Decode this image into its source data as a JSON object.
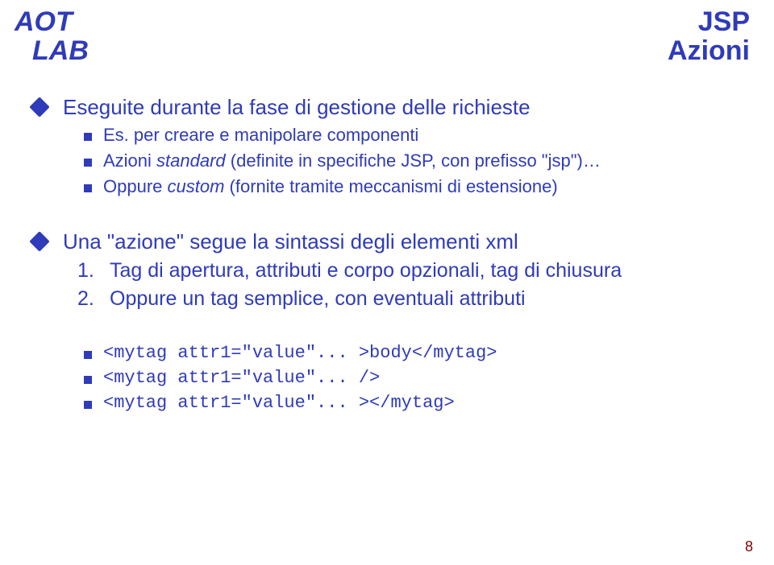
{
  "logo": {
    "line1": "AOT",
    "line2": "LAB"
  },
  "title": {
    "line1": "JSP",
    "line2": "Azioni"
  },
  "list1": {
    "main": "Eseguite durante la fase di gestione delle richieste",
    "sub1_prefix": "Es. per creare e manipolare componenti",
    "sub2_prefix": "Azioni ",
    "sub2_italic": "standard",
    "sub2_suffix": " (definite in specifiche JSP, con prefisso \"jsp\")…",
    "sub3_prefix": "Oppure ",
    "sub3_italic": "custom",
    "sub3_suffix": " (fornite tramite meccanismi di estensione)"
  },
  "list2": {
    "main": "Una \"azione\" segue la sintassi degli elementi xml",
    "items": [
      {
        "n": "1.",
        "text": "Tag di apertura, attributi e corpo opzionali, tag di chiusura"
      },
      {
        "n": "2.",
        "text": "Oppure un tag semplice, con eventuali attributi"
      }
    ]
  },
  "code": [
    "<mytag attr1=\"value\"... >body</mytag>",
    "<mytag attr1=\"value\"... />",
    "<mytag attr1=\"value\"... ></mytag>"
  ],
  "page": "8"
}
